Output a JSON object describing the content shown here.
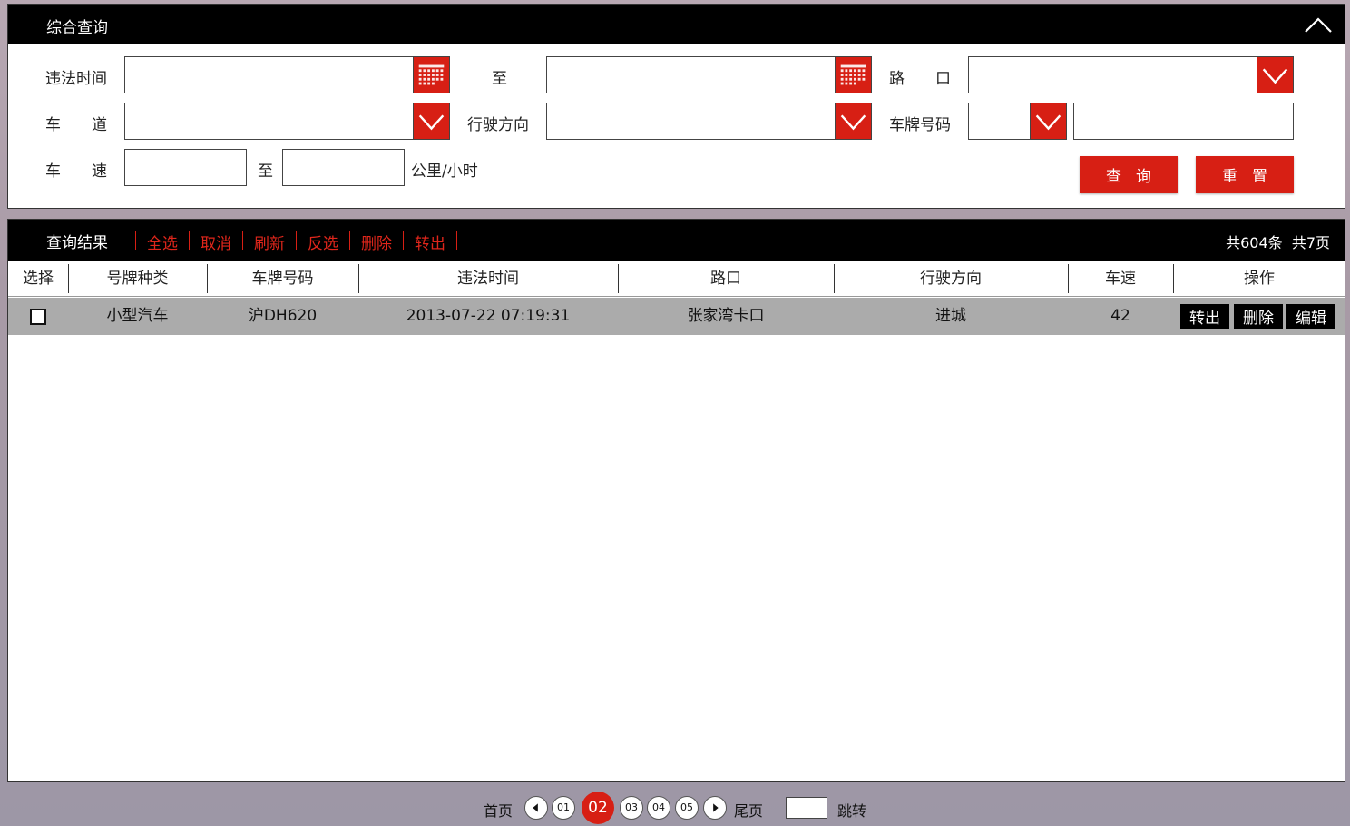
{
  "query": {
    "title": "综合查询",
    "labels": {
      "violation_time": "违法时间",
      "to_1": "至",
      "intersection": "路　　口",
      "lane": "车　　道",
      "direction": "行驶方向",
      "plate_number": "车牌号码",
      "speed": "车　　速",
      "to_2": "至",
      "unit": "公里/小时"
    },
    "inputs": {
      "time_start": "",
      "time_end": "",
      "intersection": "",
      "lane": "",
      "direction": "",
      "plate_prefix": "",
      "plate": "",
      "speed_min": "",
      "speed_max": ""
    },
    "buttons": {
      "search": "查询",
      "reset": "重置"
    }
  },
  "results": {
    "title": "查询结果",
    "actions": [
      "全选",
      "取消",
      "刷新",
      "反选",
      "删除",
      "转出"
    ],
    "total_records": "共604条",
    "total_pages": "共7页",
    "columns": [
      "选择",
      "号牌种类",
      "车牌号码",
      "违法时间",
      "路口",
      "行驶方向",
      "车速",
      "操作"
    ],
    "rows": [
      {
        "checked": false,
        "plate_type": "小型汽车",
        "plate_no": "沪DH620",
        "time": "2013-07-22 07:19:31",
        "intersection": "张家湾卡口",
        "direction": "进城",
        "speed": "42",
        "ops": [
          "转出",
          "删除",
          "编辑"
        ]
      }
    ]
  },
  "pager": {
    "first": "首页",
    "last": "尾页",
    "pages": [
      "01",
      "02",
      "03",
      "04",
      "05"
    ],
    "current": "02",
    "jump_value": "",
    "jump_label": "跳转"
  },
  "colors": {
    "accent": "#d71f14",
    "header": "#000000",
    "row_bg": "#ababab"
  },
  "icons": [
    "chevron-up-icon",
    "calendar-icon",
    "chevron-down-icon",
    "prev-page-icon",
    "next-page-icon"
  ]
}
